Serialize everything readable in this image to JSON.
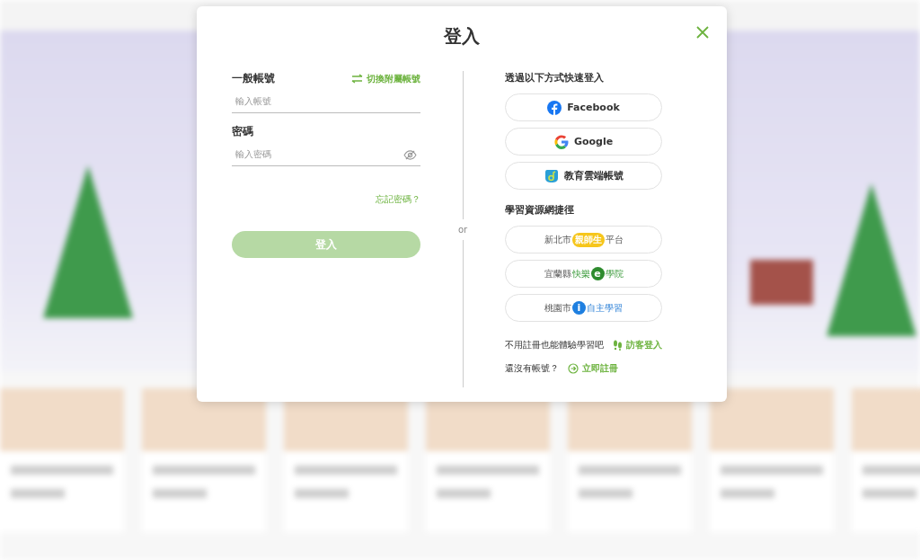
{
  "dialog": {
    "title": "登入",
    "account": {
      "label": "一般帳號",
      "switch_link": "切換附屬帳號",
      "placeholder": "輸入帳號"
    },
    "password": {
      "label": "密碼",
      "placeholder": "輸入密碼",
      "visible": false
    },
    "forgot_link": "忘記密碼？",
    "submit": {
      "label": "登入",
      "disabled": true
    },
    "separator": "or",
    "quick_login": {
      "heading": "透過以下方式快速登入",
      "buttons": [
        {
          "kind": "facebook",
          "label": "Facebook"
        },
        {
          "kind": "google",
          "label": "Google"
        },
        {
          "kind": "edu-cloud",
          "label": "教育雲端帳號"
        }
      ]
    },
    "resources": {
      "heading": "學習資源網捷徑",
      "links": [
        {
          "parts": [
            {
              "kind": "plain",
              "text": "新北市"
            },
            {
              "kind": "badge-yellow",
              "text": "親師生"
            },
            {
              "kind": "plain",
              "text": "平台"
            }
          ]
        },
        {
          "parts": [
            {
              "kind": "plain",
              "text": "宜蘭縣 "
            },
            {
              "kind": "green",
              "text": "快樂"
            },
            {
              "kind": "circle-green",
              "text": "e"
            },
            {
              "kind": "green",
              "text": "學院"
            }
          ]
        },
        {
          "parts": [
            {
              "kind": "plain",
              "text": "桃園市"
            },
            {
              "kind": "circle-blue",
              "text": "i"
            },
            {
              "kind": "blue",
              "text": "自主學習"
            }
          ]
        }
      ]
    },
    "guest": {
      "text": "不用註冊也能體驗學習吧",
      "link": "訪客登入"
    },
    "register": {
      "text": "還沒有帳號？",
      "link": "立即註冊"
    }
  }
}
